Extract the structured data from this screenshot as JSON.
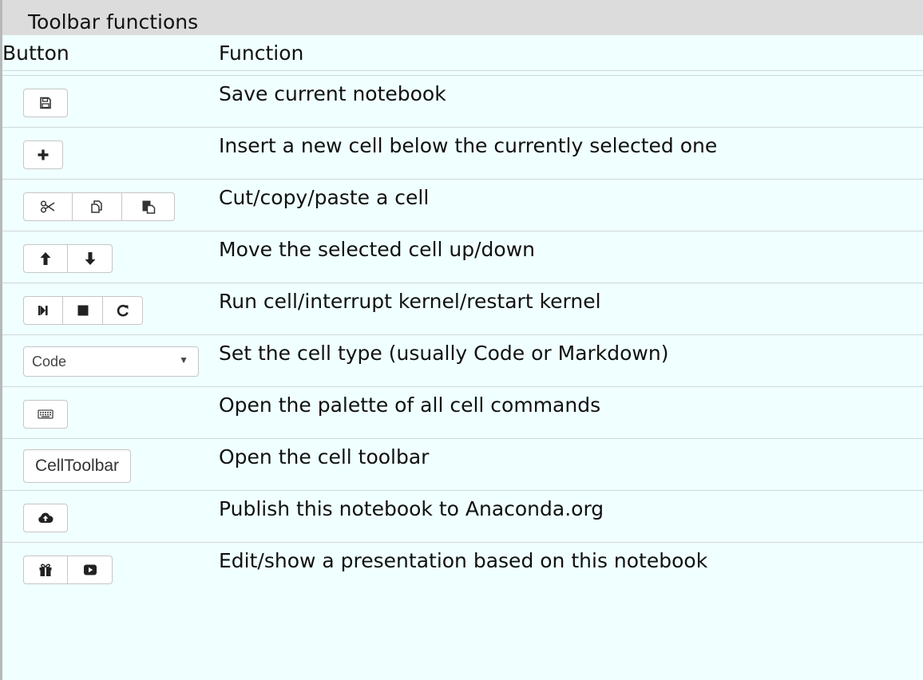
{
  "title": "Toolbar functions",
  "headers": {
    "button": "Button",
    "function": "Function"
  },
  "rows": [
    {
      "function": "Save current notebook",
      "icons": [
        "save-icon"
      ]
    },
    {
      "function": "Insert a new cell below the currently selected one",
      "icons": [
        "plus-icon"
      ]
    },
    {
      "function": "Cut/copy/paste a cell",
      "icons": [
        "scissors-icon",
        "copy-icon",
        "paste-icon"
      ]
    },
    {
      "function": "Move the selected cell up/down",
      "icons": [
        "arrow-up-icon",
        "arrow-down-icon"
      ]
    },
    {
      "function": "Run cell/interrupt kernel/restart kernel",
      "icons": [
        "step-forward-icon",
        "stop-icon",
        "refresh-icon"
      ]
    },
    {
      "function": "Set the cell type (usually Code or Markdown)",
      "select_value": "Code"
    },
    {
      "function": "Open the palette of all cell commands",
      "icons": [
        "keyboard-icon"
      ]
    },
    {
      "function": "Open the cell toolbar",
      "button_label": "CellToolbar"
    },
    {
      "function": "Publish this notebook to Anaconda.org",
      "icons": [
        "cloud-upload-icon"
      ]
    },
    {
      "function": "Edit/show a presentation based on this notebook",
      "icons": [
        "gift-icon",
        "play-icon"
      ]
    }
  ]
}
